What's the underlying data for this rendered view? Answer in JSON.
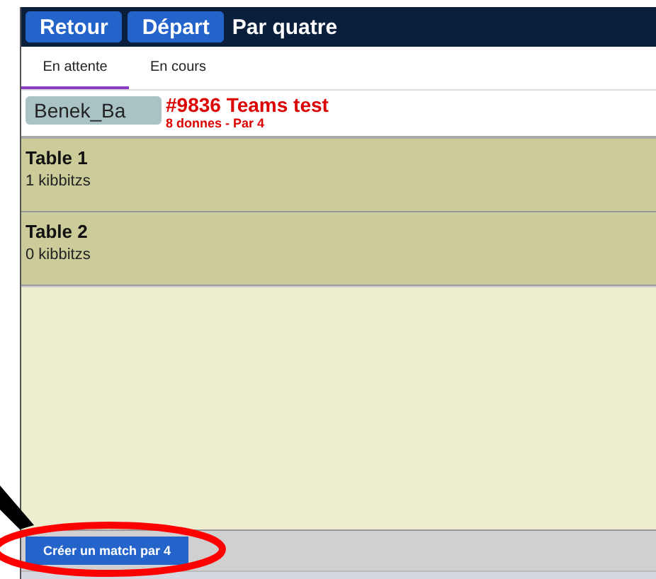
{
  "header": {
    "buttons": [
      "Retour",
      "Départ"
    ],
    "title": "Par quatre"
  },
  "tabs": [
    {
      "label": "En attente",
      "selected": true
    },
    {
      "label": "En cours",
      "selected": false
    }
  ],
  "match": {
    "player": "Benek_Ba",
    "title": "#9836 Teams test",
    "subtitle": "8 donnes - Par 4"
  },
  "tables": [
    {
      "name": "Table 1",
      "kibitz": "1 kibbitzs"
    },
    {
      "name": "Table 2",
      "kibitz": "0 kibbitzs"
    }
  ],
  "footer": {
    "button": "Créer un match par 4"
  }
}
